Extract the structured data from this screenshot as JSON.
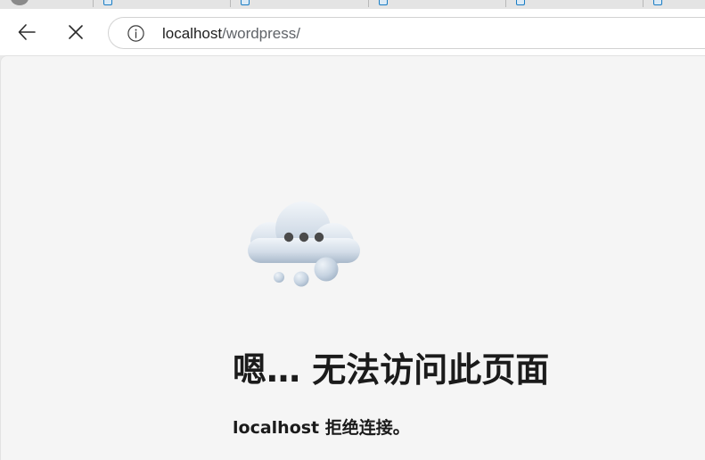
{
  "browser": {
    "address_bar": {
      "host": "localhost",
      "path": "/wordpress/"
    },
    "tabs_favicon": "document-icon",
    "back_icon": "back-arrow-icon",
    "stop_icon": "close-icon",
    "site_info_icon": "info-icon"
  },
  "error_page": {
    "illustration": "cloud-ellipsis-icon",
    "title": "嗯… 无法访问此页面",
    "detail": "localhost 拒绝连接。"
  }
}
